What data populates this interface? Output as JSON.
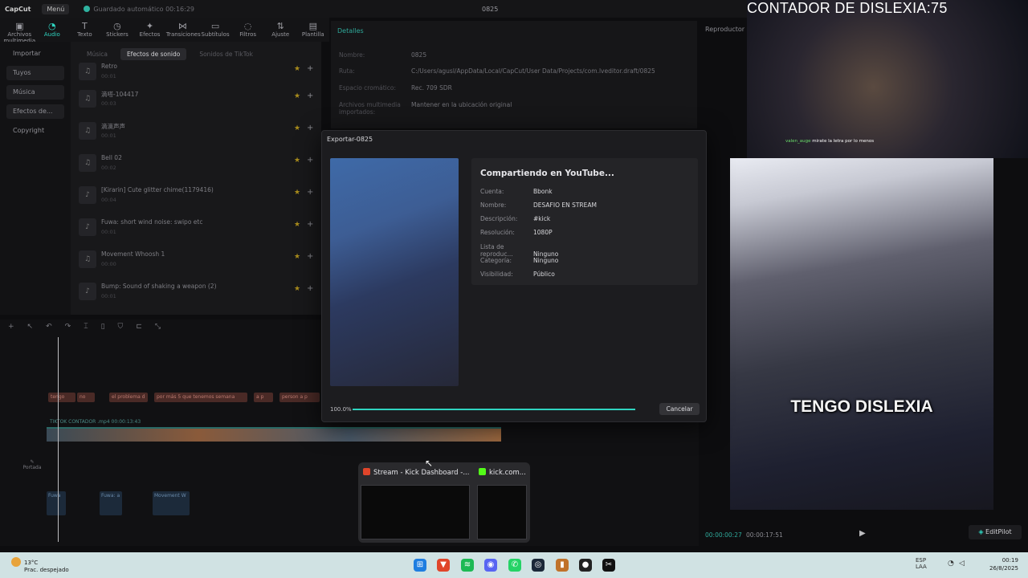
{
  "app": {
    "logo": "CapCut",
    "menu": "Menú",
    "autosave": "Guardado automático 00:16:29",
    "project": "0825"
  },
  "toolbar": [
    {
      "label": "Archivos multimedia",
      "icon": "media-icon"
    },
    {
      "label": "Audio",
      "icon": "audio-icon",
      "active": true
    },
    {
      "label": "Texto",
      "icon": "text-icon"
    },
    {
      "label": "Stickers",
      "icon": "sticker-icon"
    },
    {
      "label": "Efectos",
      "icon": "effects-icon"
    },
    {
      "label": "Transiciones",
      "icon": "transitions-icon"
    },
    {
      "label": "Subtítulos",
      "icon": "subtitles-icon"
    },
    {
      "label": "Filtros",
      "icon": "filters-icon"
    },
    {
      "label": "Ajuste",
      "icon": "adjust-icon"
    },
    {
      "label": "Plantilla",
      "icon": "template-icon"
    }
  ],
  "leftnav": [
    "Importar",
    "Tuyos",
    "Música",
    "Efectos de...",
    "Copyright"
  ],
  "audio_filters": [
    "Música",
    "Efectos de sonido",
    "Sonidos de TikTok"
  ],
  "audio_items": [
    {
      "name": "Retro",
      "sub": "00:01"
    },
    {
      "name": "滴嗒-104417",
      "sub": "00:03"
    },
    {
      "name": "滴滴声声",
      "sub": "00:01"
    },
    {
      "name": "Bell 02",
      "sub": "00:02"
    },
    {
      "name": "[Kirarin] Cute glitter chime(1179416)",
      "sub": "00:04"
    },
    {
      "name": "Fuwa: short wind noise: swipo etc",
      "sub": "00:01"
    },
    {
      "name": "Movement Whoosh 1",
      "sub": "00:00"
    },
    {
      "name": "Bump: Sound of shaking a weapon (2)",
      "sub": "00:01"
    }
  ],
  "details": {
    "header": "Detalles",
    "rows": [
      {
        "k": "Nombre:",
        "v": "0825"
      },
      {
        "k": "Ruta:",
        "v": "C:/Users/agusl/AppData/Local/CapCut/User Data/Projects/com.lveditor.draft/0825"
      },
      {
        "k": "Espacio cromático:",
        "v": "Rec. 709 SDR"
      },
      {
        "k": "Archivos multimedia importados:",
        "v": "Mantener en la ubicación original"
      }
    ]
  },
  "player": {
    "label": "Reproductor",
    "time_current": "00:00:00:27",
    "time_total": "00:00:17:51",
    "editpilot": "EditPilot"
  },
  "timeline": {
    "text_clips": [
      "tengo",
      "no",
      "el problema d",
      "por más 5 que tenemos semana",
      "a p",
      "person a p"
    ],
    "video_label": "TIKTOK CONTADOR .mp4  00:00:13:43",
    "audio_clips": [
      "Fuwa",
      "Fuwa: a",
      "Movement W"
    ],
    "cover_label": "Portada"
  },
  "export": {
    "title": "Exportar-0825",
    "heading": "Compartiendo en YouTube...",
    "rows": [
      {
        "k": "Cuenta:",
        "v": "Bbonk"
      },
      {
        "k": "Nombre:",
        "v": "DESAFIO EN STREAM"
      },
      {
        "k": "Descripción:",
        "v": "#kick"
      },
      {
        "k": "Resolución:",
        "v": "1080P"
      },
      {
        "k": "Lista de reproduc...",
        "v": "Ninguno"
      },
      {
        "k": "Categoría:",
        "v": "Ninguno"
      },
      {
        "k": "Visibilidad:",
        "v": "Público"
      }
    ],
    "progress_label": "100.0%",
    "progress": 1.0,
    "cancel": "Cancelar"
  },
  "overlay": {
    "counter": "CONTADOR DE DISLEXIA:75",
    "chat_user": "valen_auge",
    "chat_text": "mirate la letra por lo menos",
    "caption": "TENGO DISLEXIA"
  },
  "taskbar_popup": [
    {
      "title": "Stream - Kick Dashboard -...",
      "icon": "brave-icon",
      "color": "#e0452a"
    },
    {
      "title": "kick.com...",
      "icon": "kick-icon",
      "color": "#53fc18"
    }
  ],
  "taskbar": {
    "weather_temp": "13°C",
    "weather_desc": "Prac. despejado",
    "lang_top": "ESP",
    "lang_bottom": "LAA",
    "time": "00:19",
    "date": "26/8/2025",
    "apps": [
      {
        "name": "windows-start-icon",
        "color": "#1f7ee0",
        "glyph": "⊞"
      },
      {
        "name": "brave-icon",
        "color": "#e0452a",
        "glyph": "▼"
      },
      {
        "name": "spotify-icon",
        "color": "#1db954",
        "glyph": "≋"
      },
      {
        "name": "discord-icon",
        "color": "#5865f2",
        "glyph": "◉"
      },
      {
        "name": "whatsapp-icon",
        "color": "#25d366",
        "glyph": "✆"
      },
      {
        "name": "steam-icon",
        "color": "#1b2838",
        "glyph": "◎"
      },
      {
        "name": "app-icon",
        "color": "#c0722a",
        "glyph": "▮"
      },
      {
        "name": "obs-icon",
        "color": "#222222",
        "glyph": "●"
      },
      {
        "name": "capcut-icon",
        "color": "#111111",
        "glyph": "✂"
      }
    ]
  }
}
